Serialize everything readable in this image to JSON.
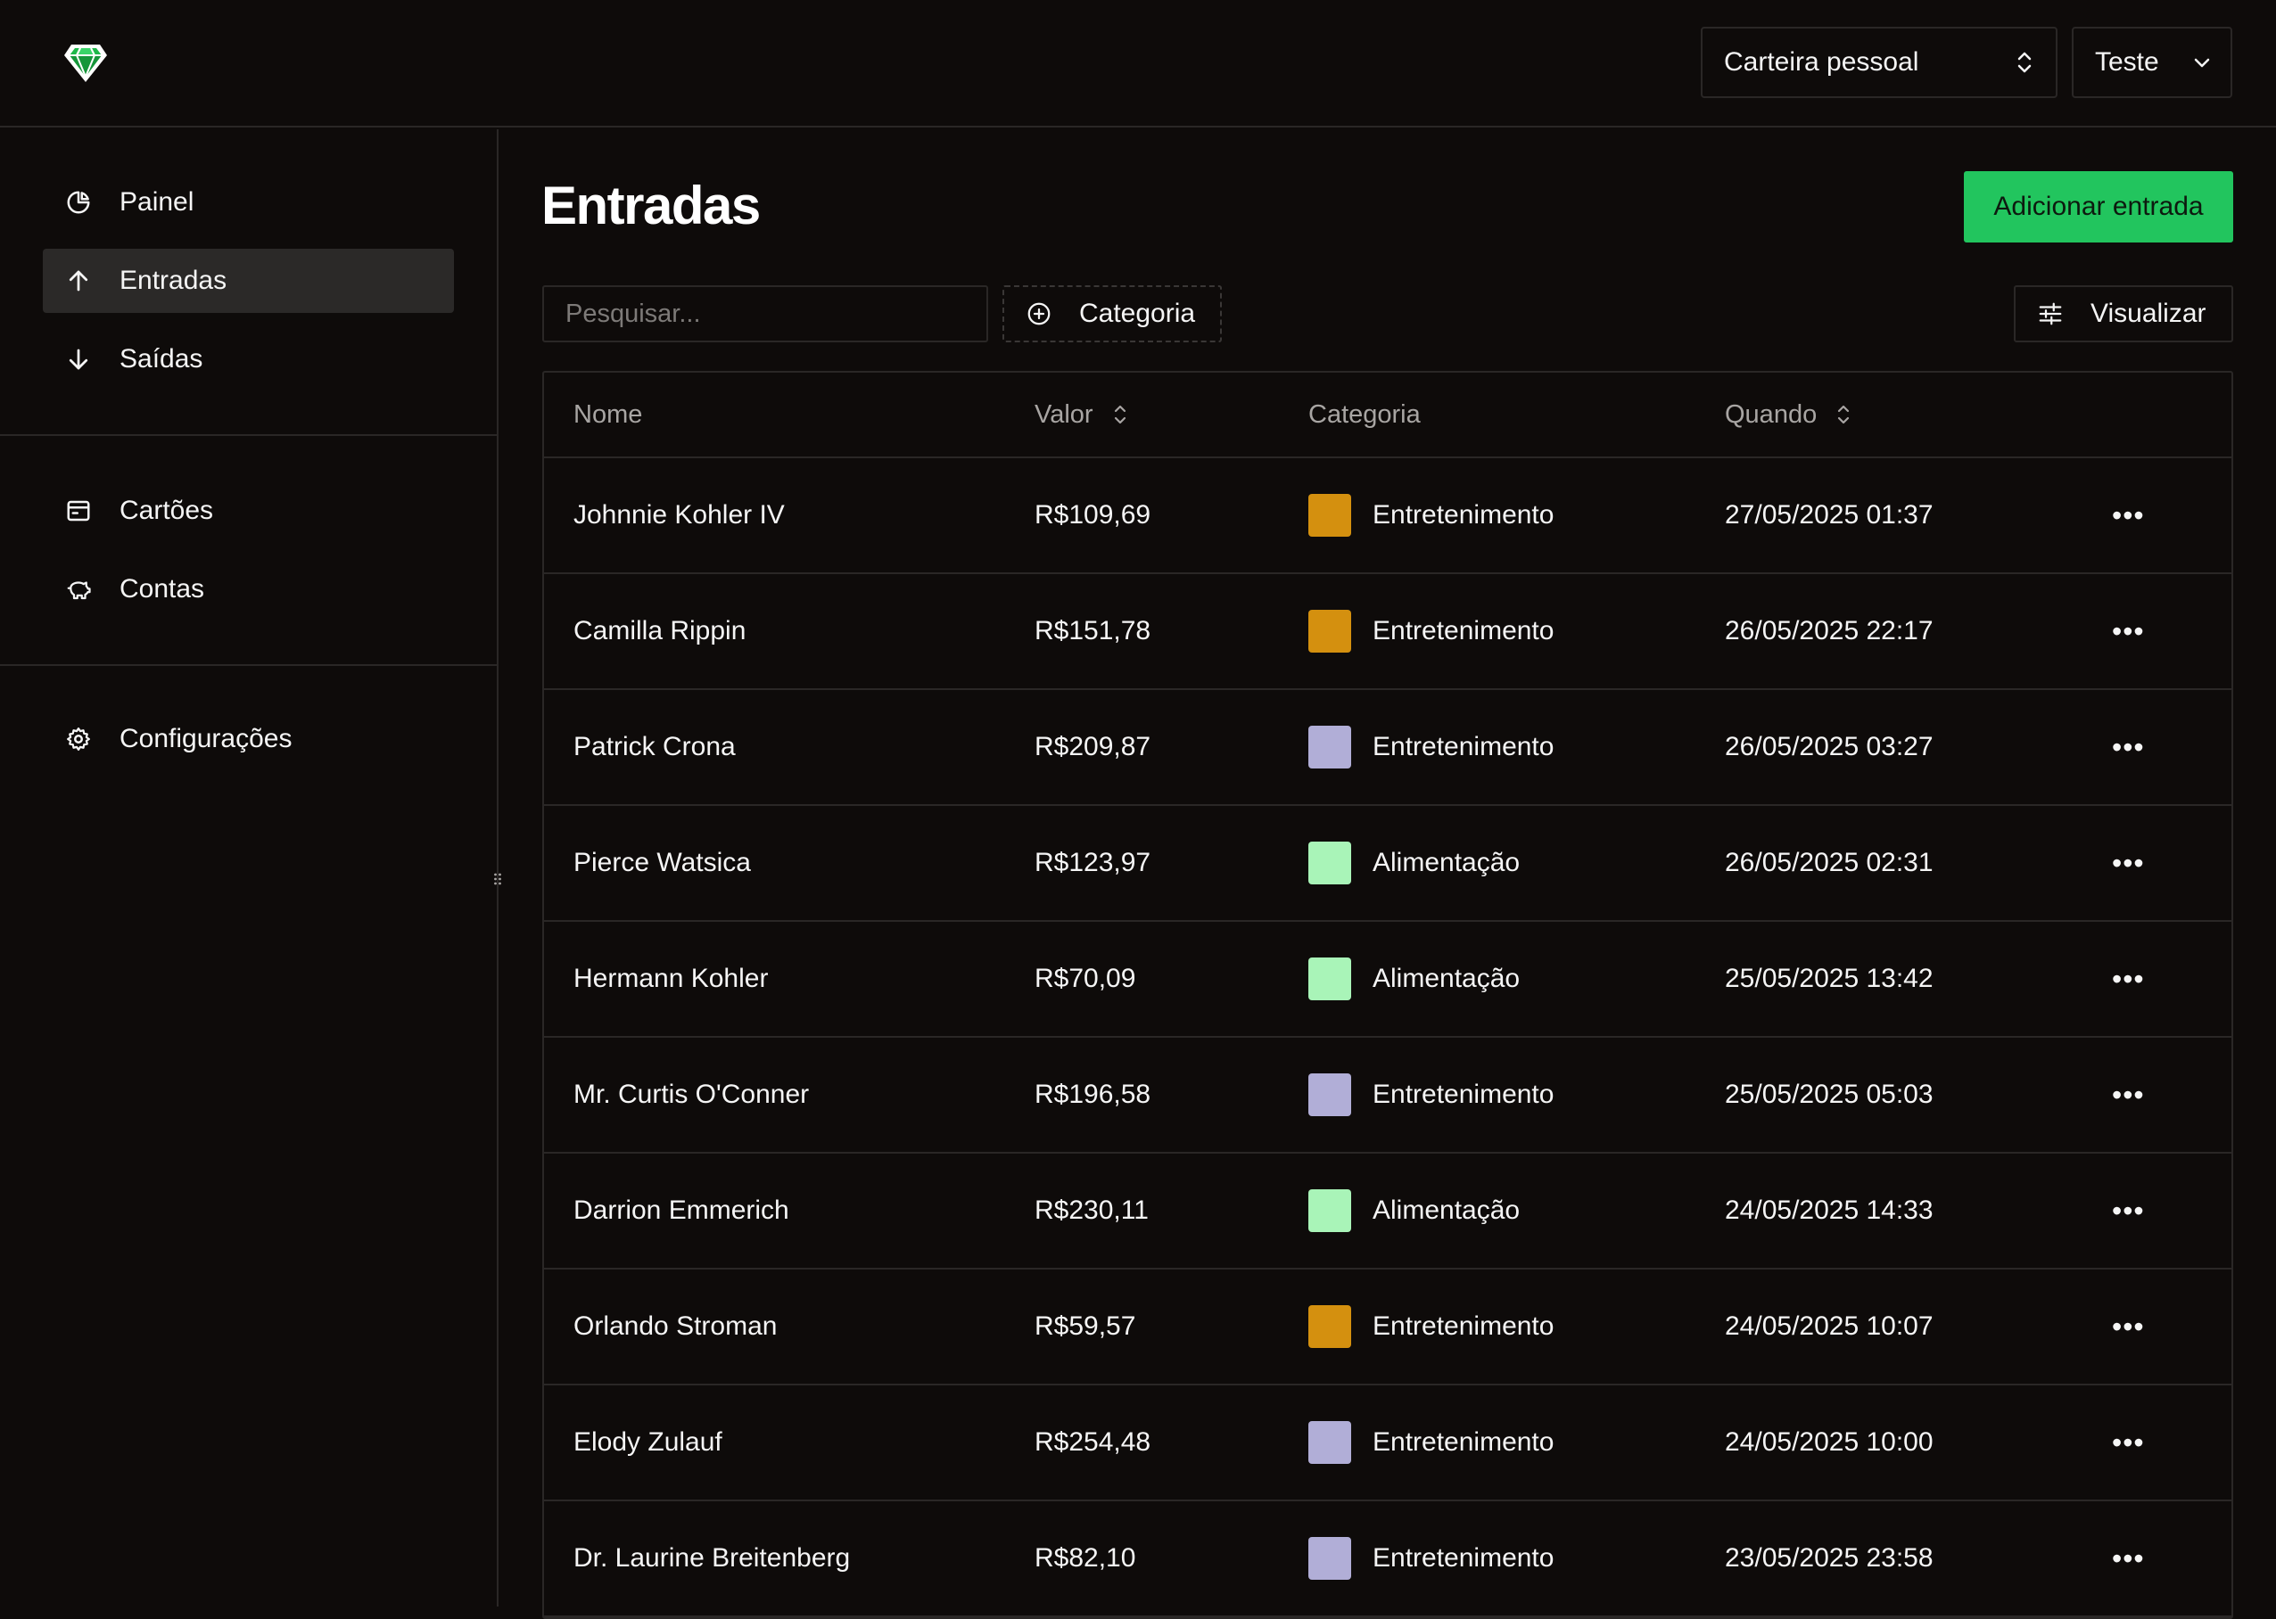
{
  "header": {
    "logo_icon": "diamond-logo-icon",
    "wallet_select": {
      "value": "Carteira pessoal",
      "icon": "chevron-up-down-icon"
    },
    "user_select": {
      "value": "Teste",
      "icon": "chevron-down-icon"
    }
  },
  "sidebar": {
    "groups": [
      [
        {
          "label": "Painel",
          "icon": "pie-chart-icon",
          "active": false
        },
        {
          "label": "Entradas",
          "icon": "arrow-up-icon",
          "active": true
        },
        {
          "label": "Saídas",
          "icon": "arrow-down-icon",
          "active": false
        }
      ],
      [
        {
          "label": "Cartões",
          "icon": "card-icon",
          "active": false
        },
        {
          "label": "Contas",
          "icon": "piggy-bank-icon",
          "active": false
        }
      ],
      [
        {
          "label": "Configurações",
          "icon": "gear-icon",
          "active": false
        }
      ]
    ]
  },
  "main": {
    "title": "Entradas",
    "add_button": "Adicionar entrada",
    "search": {
      "placeholder": "Pesquisar...",
      "value": ""
    },
    "category_filter": "Categoria",
    "view_button": "Visualizar"
  },
  "table": {
    "columns": {
      "name": "Nome",
      "value": "Valor",
      "category": "Categoria",
      "when": "Quando"
    },
    "rows": [
      {
        "name": "Johnnie Kohler IV",
        "value": "R$109,69",
        "category": "Entretenimento",
        "color": "#d4900f",
        "when": "27/05/2025 01:37"
      },
      {
        "name": "Camilla Rippin",
        "value": "R$151,78",
        "category": "Entretenimento",
        "color": "#d4900f",
        "when": "26/05/2025 22:17"
      },
      {
        "name": "Patrick Crona",
        "value": "R$209,87",
        "category": "Entretenimento",
        "color": "#b1aed7",
        "when": "26/05/2025 03:27"
      },
      {
        "name": "Pierce Watsica",
        "value": "R$123,97",
        "category": "Alimentação",
        "color": "#a9f4b8",
        "when": "26/05/2025 02:31"
      },
      {
        "name": "Hermann Kohler",
        "value": "R$70,09",
        "category": "Alimentação",
        "color": "#a9f4b8",
        "when": "25/05/2025 13:42"
      },
      {
        "name": "Mr. Curtis O'Conner",
        "value": "R$196,58",
        "category": "Entretenimento",
        "color": "#b1aed7",
        "when": "25/05/2025 05:03"
      },
      {
        "name": "Darrion Emmerich",
        "value": "R$230,11",
        "category": "Alimentação",
        "color": "#a9f4b8",
        "when": "24/05/2025 14:33"
      },
      {
        "name": "Orlando Stroman",
        "value": "R$59,57",
        "category": "Entretenimento",
        "color": "#d4900f",
        "when": "24/05/2025 10:07"
      },
      {
        "name": "Elody Zulauf",
        "value": "R$254,48",
        "category": "Entretenimento",
        "color": "#b1aed7",
        "when": "24/05/2025 10:00"
      },
      {
        "name": "Dr. Laurine Breitenberg",
        "value": "R$82,10",
        "category": "Entretenimento",
        "color": "#b1aed7",
        "when": "23/05/2025 23:58"
      }
    ]
  },
  "colors": {
    "background": "#0e0b0a",
    "border": "#2a2726",
    "accent": "#22c55e",
    "active_nav": "#2b2928"
  }
}
